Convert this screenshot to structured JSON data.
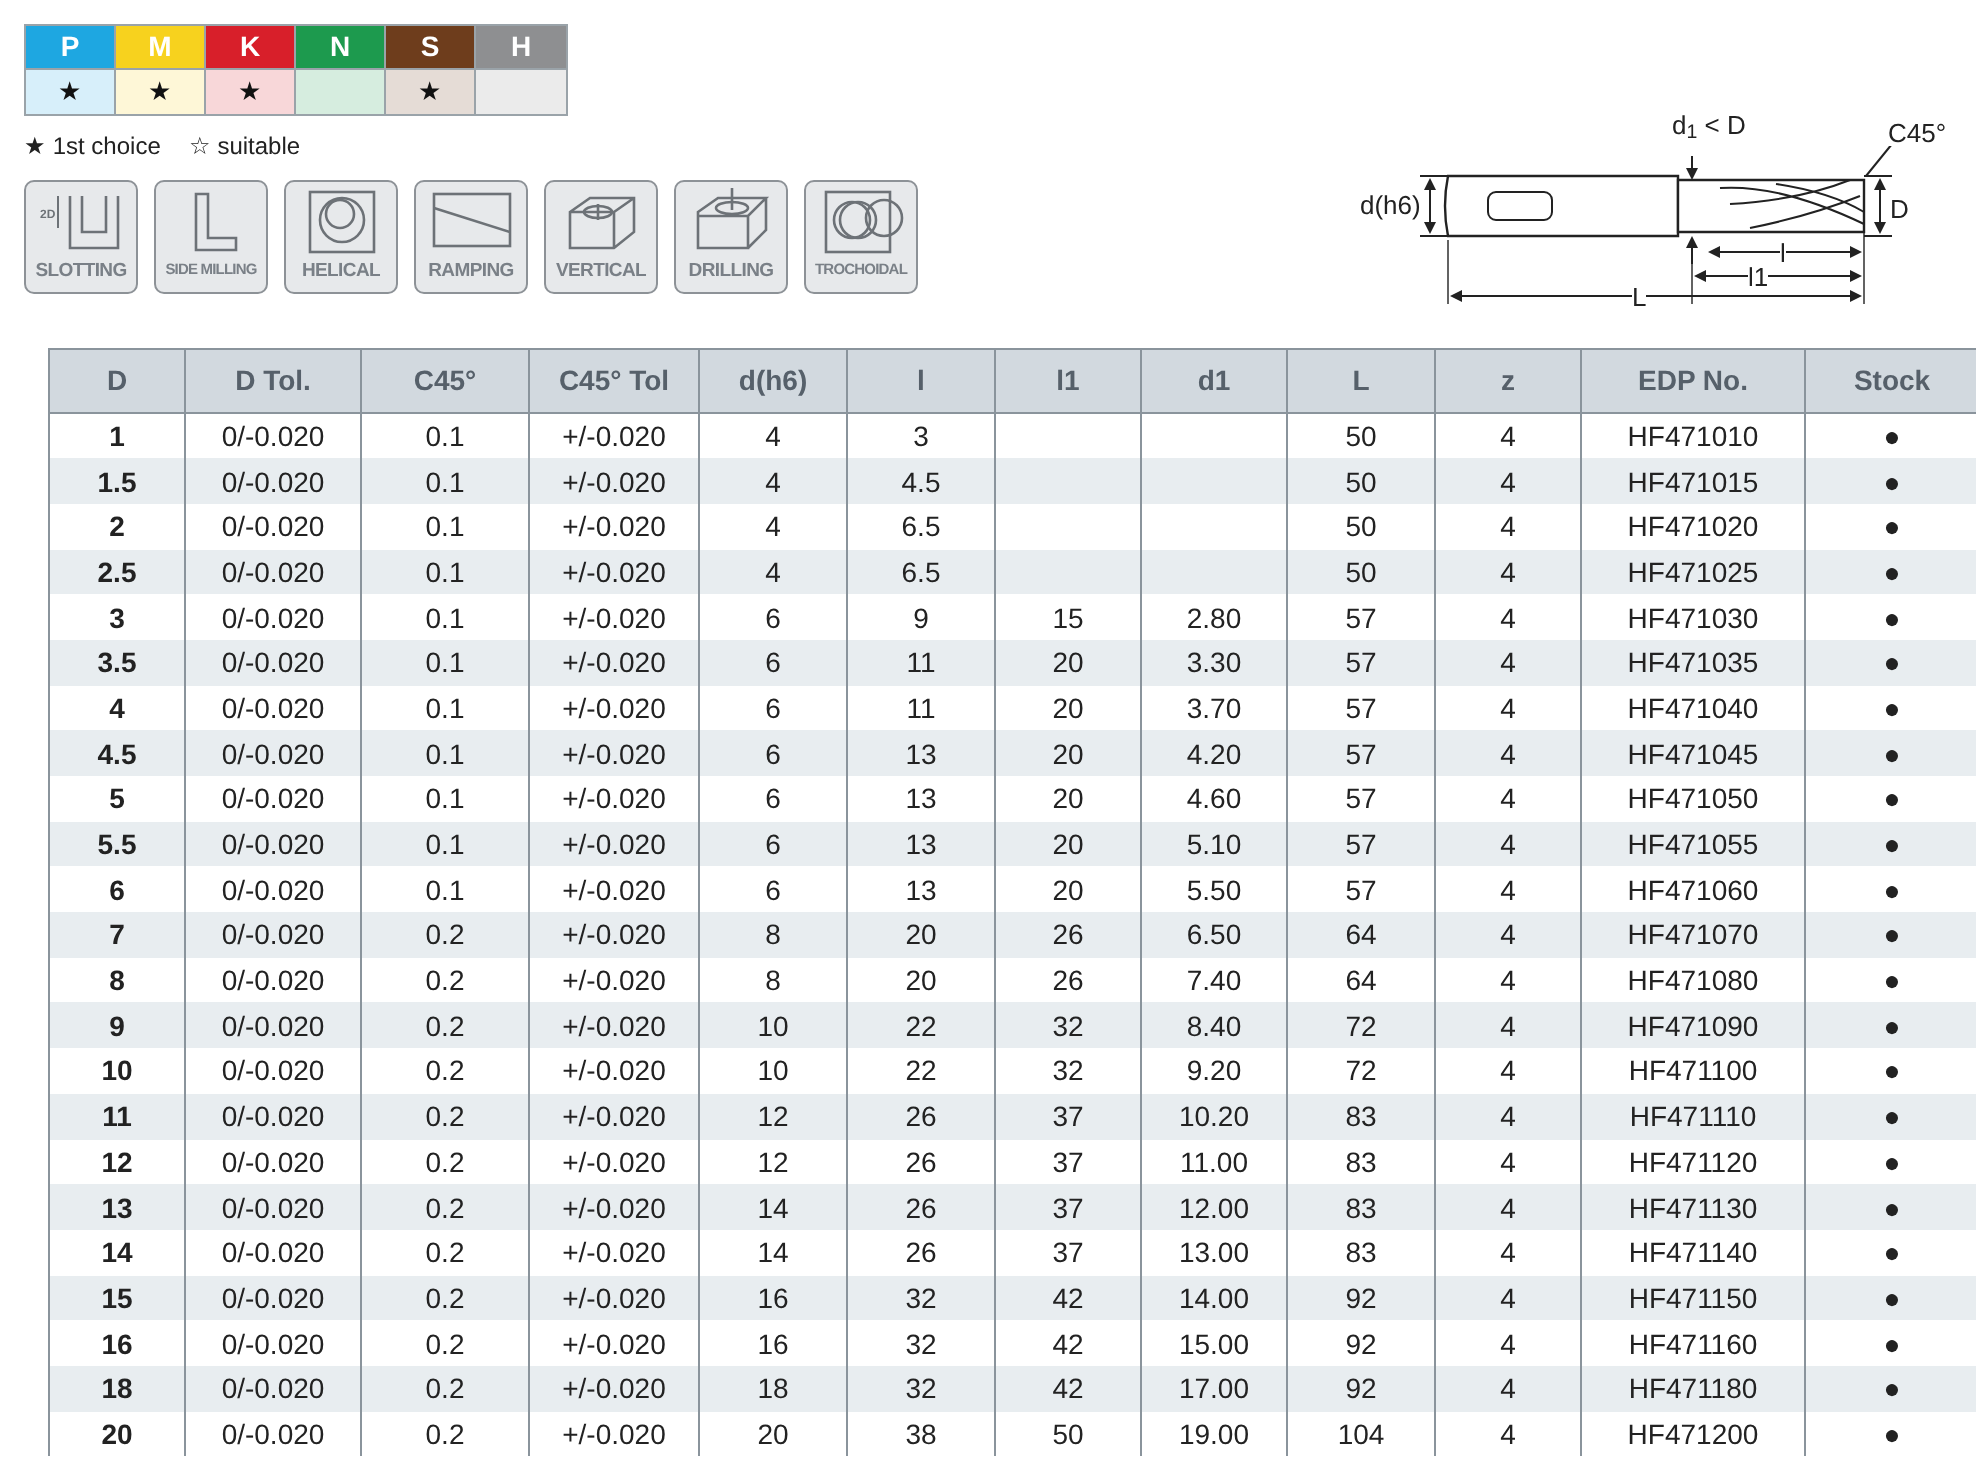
{
  "materials": [
    {
      "letter": "P",
      "color": "#1ea7e1",
      "mark": "★"
    },
    {
      "letter": "M",
      "color": "#f7d21e",
      "mark": "★"
    },
    {
      "letter": "K",
      "color": "#d81f2a",
      "mark": "★"
    },
    {
      "letter": "N",
      "color": "#1d9a4e"
    },
    {
      "letter": "S",
      "color": "#6e3d1c",
      "mark": "★"
    },
    {
      "letter": "H",
      "color": "#8e8f91"
    }
  ],
  "legend": [
    {
      "symbol": "★",
      "text": "1st choice"
    },
    {
      "symbol": "☆",
      "text": "suitable"
    }
  ],
  "operations": [
    {
      "kind": "slotting",
      "label": "SLOTTING",
      "note": "2D"
    },
    {
      "kind": "side",
      "label": "SIDE MILLING"
    },
    {
      "kind": "helical",
      "label": "HELICAL"
    },
    {
      "kind": "ramping",
      "label": "RAMPING"
    },
    {
      "kind": "vertical",
      "label": "VERTICAL"
    },
    {
      "kind": "drilling",
      "label": "DRILLING"
    },
    {
      "kind": "trochoidal",
      "label": "TROCHOIDAL"
    }
  ],
  "diagram": {
    "labels": {
      "neck": "d$_{1}$ < D",
      "chamfer": "C45°",
      "shank": "d(h6)",
      "diameter": "D",
      "flute": "l",
      "reach": "l1",
      "length": "L"
    }
  },
  "table": {
    "columns": [
      "D",
      "D Tol.",
      "C45°",
      "C45° Tol",
      "d(h6)",
      "l",
      "l1",
      "d1",
      "L",
      "z",
      "EDP No.",
      "Stock"
    ],
    "rows": [
      [
        "1",
        "0/-0.020",
        "0.1",
        "+/-0.020",
        "4",
        "3",
        "",
        "",
        "50",
        "4",
        "HF471010",
        "●"
      ],
      [
        "1.5",
        "0/-0.020",
        "0.1",
        "+/-0.020",
        "4",
        "4.5",
        "",
        "",
        "50",
        "4",
        "HF471015",
        "●"
      ],
      [
        "2",
        "0/-0.020",
        "0.1",
        "+/-0.020",
        "4",
        "6.5",
        "",
        "",
        "50",
        "4",
        "HF471020",
        "●"
      ],
      [
        "2.5",
        "0/-0.020",
        "0.1",
        "+/-0.020",
        "4",
        "6.5",
        "",
        "",
        "50",
        "4",
        "HF471025",
        "●"
      ],
      [
        "3",
        "0/-0.020",
        "0.1",
        "+/-0.020",
        "6",
        "9",
        "15",
        "2.80",
        "57",
        "4",
        "HF471030",
        "●"
      ],
      [
        "3.5",
        "0/-0.020",
        "0.1",
        "+/-0.020",
        "6",
        "11",
        "20",
        "3.30",
        "57",
        "4",
        "HF471035",
        "●"
      ],
      [
        "4",
        "0/-0.020",
        "0.1",
        "+/-0.020",
        "6",
        "11",
        "20",
        "3.70",
        "57",
        "4",
        "HF471040",
        "●"
      ],
      [
        "4.5",
        "0/-0.020",
        "0.1",
        "+/-0.020",
        "6",
        "13",
        "20",
        "4.20",
        "57",
        "4",
        "HF471045",
        "●"
      ],
      [
        "5",
        "0/-0.020",
        "0.1",
        "+/-0.020",
        "6",
        "13",
        "20",
        "4.60",
        "57",
        "4",
        "HF471050",
        "●"
      ],
      [
        "5.5",
        "0/-0.020",
        "0.1",
        "+/-0.020",
        "6",
        "13",
        "20",
        "5.10",
        "57",
        "4",
        "HF471055",
        "●"
      ],
      [
        "6",
        "0/-0.020",
        "0.1",
        "+/-0.020",
        "6",
        "13",
        "20",
        "5.50",
        "57",
        "4",
        "HF471060",
        "●"
      ],
      [
        "7",
        "0/-0.020",
        "0.2",
        "+/-0.020",
        "8",
        "20",
        "26",
        "6.50",
        "64",
        "4",
        "HF471070",
        "●"
      ],
      [
        "8",
        "0/-0.020",
        "0.2",
        "+/-0.020",
        "8",
        "20",
        "26",
        "7.40",
        "64",
        "4",
        "HF471080",
        "●"
      ],
      [
        "9",
        "0/-0.020",
        "0.2",
        "+/-0.020",
        "10",
        "22",
        "32",
        "8.40",
        "72",
        "4",
        "HF471090",
        "●"
      ],
      [
        "10",
        "0/-0.020",
        "0.2",
        "+/-0.020",
        "10",
        "22",
        "32",
        "9.20",
        "72",
        "4",
        "HF471100",
        "●"
      ],
      [
        "11",
        "0/-0.020",
        "0.2",
        "+/-0.020",
        "12",
        "26",
        "37",
        "10.20",
        "83",
        "4",
        "HF471110",
        "●"
      ],
      [
        "12",
        "0/-0.020",
        "0.2",
        "+/-0.020",
        "12",
        "26",
        "37",
        "11.00",
        "83",
        "4",
        "HF471120",
        "●"
      ],
      [
        "13",
        "0/-0.020",
        "0.2",
        "+/-0.020",
        "14",
        "26",
        "37",
        "12.00",
        "83",
        "4",
        "HF471130",
        "●"
      ],
      [
        "14",
        "0/-0.020",
        "0.2",
        "+/-0.020",
        "14",
        "26",
        "37",
        "13.00",
        "83",
        "4",
        "HF471140",
        "●"
      ],
      [
        "15",
        "0/-0.020",
        "0.2",
        "+/-0.020",
        "16",
        "32",
        "42",
        "14.00",
        "92",
        "4",
        "HF471150",
        "●"
      ],
      [
        "16",
        "0/-0.020",
        "0.2",
        "+/-0.020",
        "16",
        "32",
        "42",
        "15.00",
        "92",
        "4",
        "HF471160",
        "●"
      ],
      [
        "18",
        "0/-0.020",
        "0.2",
        "+/-0.020",
        "18",
        "32",
        "42",
        "17.00",
        "92",
        "4",
        "HF471180",
        "●"
      ],
      [
        "20",
        "0/-0.020",
        "0.2",
        "+/-0.020",
        "20",
        "38",
        "50",
        "19.00",
        "104",
        "4",
        "HF471200",
        "●"
      ]
    ]
  }
}
